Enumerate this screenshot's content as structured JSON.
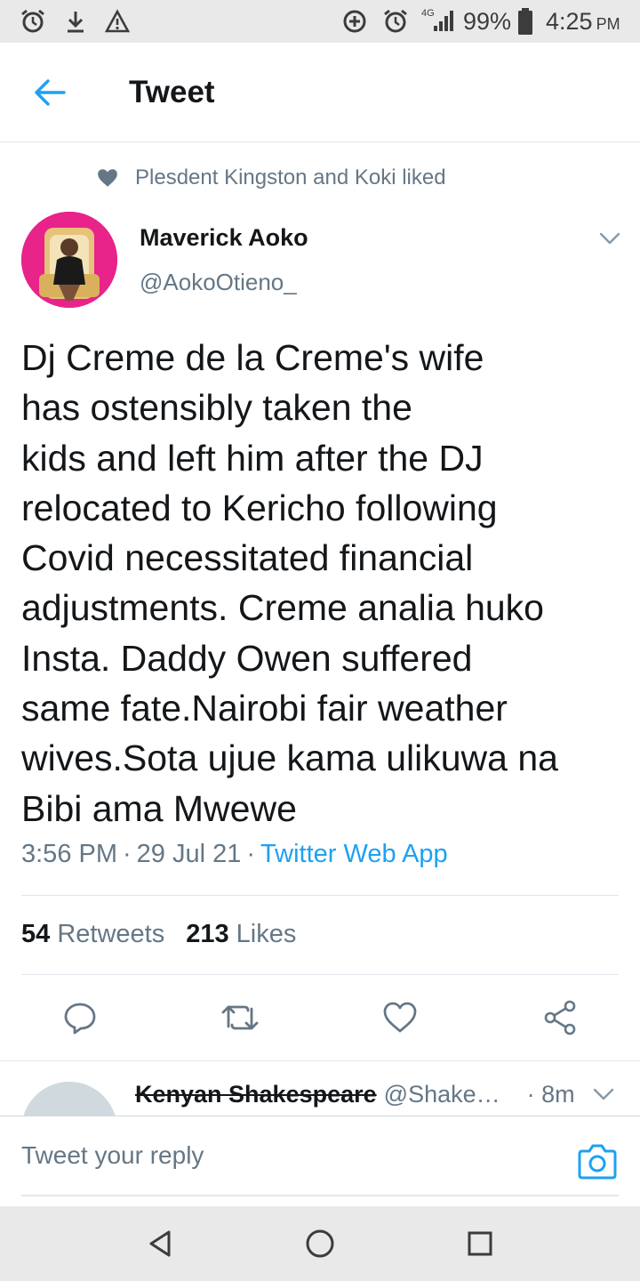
{
  "status_bar": {
    "battery_percent": "99%",
    "time": "4:25",
    "ampm": "PM",
    "network": "4G",
    "icons": [
      "alarm-icon",
      "download-icon",
      "warning-icon",
      "data-saver-icon",
      "alarm-icon",
      "signal-icon",
      "battery-icon"
    ]
  },
  "header": {
    "title": "Tweet",
    "back_icon": "arrow-left-icon",
    "accent_color": "#1da1f2"
  },
  "social_context": {
    "text": "Plesdent Kingston and Koki liked",
    "icon": "heart-icon"
  },
  "tweet": {
    "author_name": "Maverick Aoko",
    "author_handle": "@AokoOtieno_",
    "text": "Dj Creme de la Creme's wife\nhas ostensibly taken the\nkids and left him after the DJ\nrelocated to Kericho following\nCovid necessitated financial\nadjustments. Creme analia huko\nInsta. Daddy Owen suffered\nsame fate.Nairobi fair weather\nwives.Sota ujue kama ulikuwa na\nBibi ama Mwewe",
    "time": "3:56 PM",
    "date": "29 Jul 21",
    "separator": "·",
    "source": "Twitter Web App",
    "retweets_count": "54",
    "retweets_label": "Retweets",
    "likes_count": "213",
    "likes_label": "Likes"
  },
  "actions": {
    "icons": [
      "reply-icon",
      "retweet-icon",
      "like-icon",
      "share-icon"
    ]
  },
  "reply_preview": {
    "name": "Kenyan Shakespeare",
    "handle": "@Shake…",
    "time": "· 8m"
  },
  "composer": {
    "placeholder": "Tweet your reply",
    "camera_icon": "camera-icon"
  },
  "navbar": {
    "icons": [
      "back-triangle-icon",
      "home-circle-icon",
      "recents-square-icon"
    ]
  }
}
